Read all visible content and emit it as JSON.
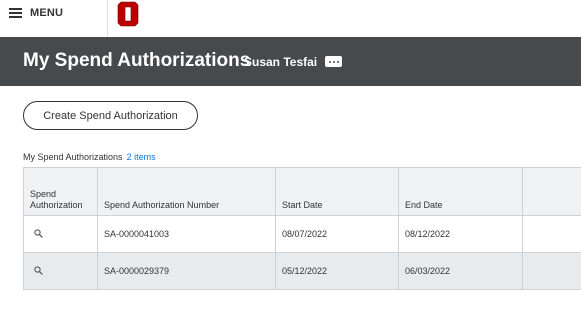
{
  "topbar": {
    "menu_label": "MENU",
    "logo_icon": "ohio-state-block-o-logo"
  },
  "header": {
    "title": "My Spend Authorizations",
    "user_name": "Susan Tesfai",
    "more_icon": "more-options-icon"
  },
  "actions": {
    "create_label": "Create Spend Authorization"
  },
  "grid": {
    "title": "My Spend Authorizations",
    "count": "2 items",
    "columns": [
      "Spend Authorization",
      "Spend Authorization Number",
      "Start Date",
      "End Date",
      ""
    ],
    "rows": [
      {
        "number": "SA-0000041003",
        "start": "08/07/2022",
        "end": "08/12/2022"
      },
      {
        "number": "SA-0000029379",
        "start": "05/12/2022",
        "end": "06/03/2022"
      }
    ]
  },
  "colors": {
    "header_bg": "#464a4d",
    "logo_red": "#bb0000",
    "link_blue": "#0875e1",
    "row_alt": "#e8ebed"
  }
}
